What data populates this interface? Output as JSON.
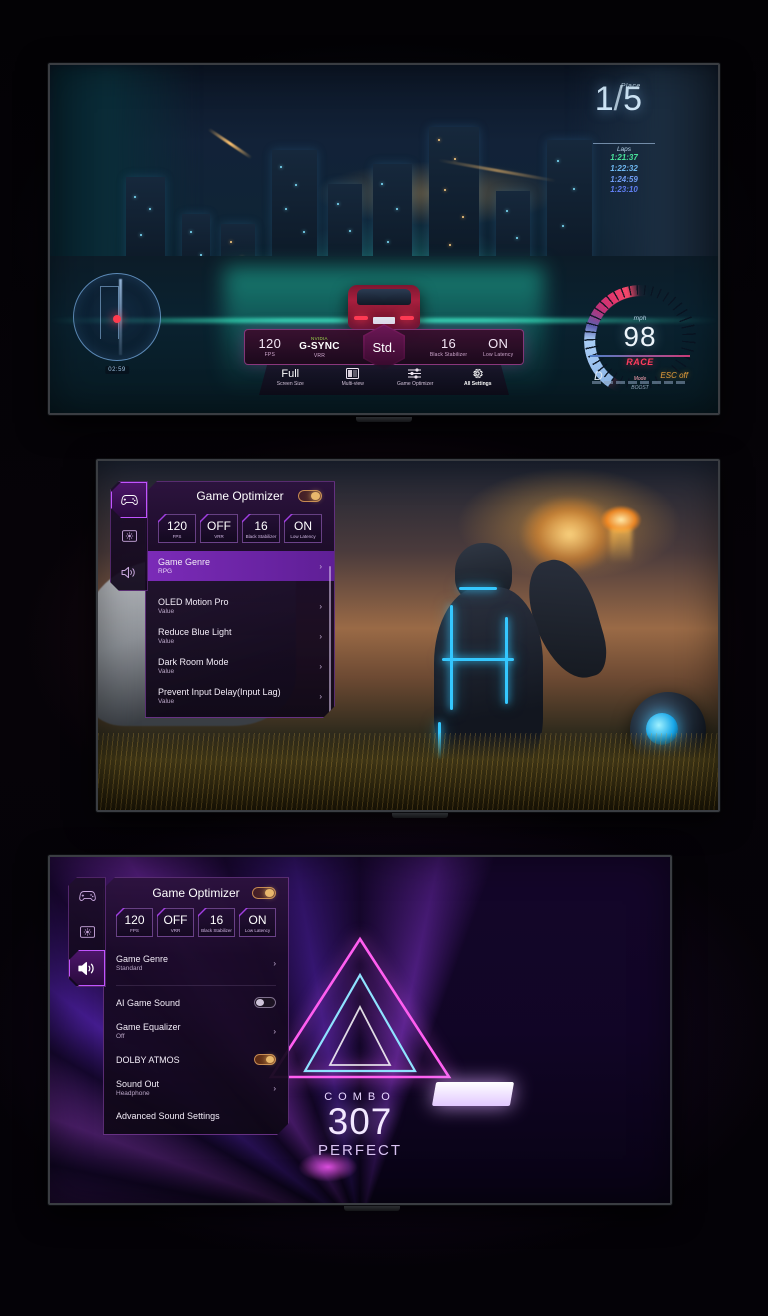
{
  "panel1": {
    "name": "LG TV racing game screen with Game Optimizer quick bar",
    "hud": {
      "place_label": "Place",
      "position": "1",
      "total": "5",
      "laps_label": "Laps",
      "lap_times": [
        "1:21:37",
        "1:22:32",
        "1:24:59",
        "1:23:10"
      ],
      "lap_colors": [
        "#49e39b",
        "#6fb9f2",
        "#6f9bf2",
        "#5f7df0"
      ],
      "minimap_time": "02:59",
      "speed": {
        "unit": "mph",
        "value": "98",
        "mode": "RACE",
        "mode_sub": "Mode",
        "gear": "D",
        "esc": "ESC off",
        "boost_label": "BOOST"
      }
    },
    "gamebar": {
      "stats": [
        {
          "value": "120",
          "label": "FPS"
        },
        {
          "value": "G-SYNC",
          "label": "VRR",
          "brand": "NVIDIA"
        },
        {
          "value": "16",
          "label": "Black Stabilizer"
        },
        {
          "value": "ON",
          "label": "Low Latency"
        }
      ],
      "mode": "Std.",
      "menu": [
        {
          "value": "Full",
          "label": "Screen Size",
          "icon": "text-icon",
          "active": false
        },
        {
          "value": "",
          "label": "Multi-view",
          "icon": "multiview-icon",
          "active": false
        },
        {
          "value": "",
          "label": "Game Optimizer",
          "icon": "sliders-icon",
          "active": false
        },
        {
          "value": "",
          "label": "All Settings",
          "icon": "gear-icon",
          "active": true
        }
      ],
      "help_icon": "question-icon"
    }
  },
  "panel2": {
    "name": "LG TV sci-fi game screen with Game Optimizer picture menu",
    "optimizer": {
      "title": "Game Optimizer",
      "toggle_on": true,
      "rail": [
        {
          "icon": "gamepad-icon",
          "name": "tab-game",
          "active": true
        },
        {
          "icon": "display-icon",
          "name": "tab-picture",
          "active": false
        },
        {
          "icon": "speaker-icon",
          "name": "tab-sound",
          "active": false
        }
      ],
      "chips": [
        {
          "value": "120",
          "label": "FPS"
        },
        {
          "value": "OFF",
          "label": "VRR"
        },
        {
          "value": "16",
          "label": "Black Stabilizer"
        },
        {
          "value": "ON",
          "label": "Low Latency"
        }
      ],
      "rows": [
        {
          "title": "Game Genre",
          "sub": "RPG",
          "control": "chevron",
          "selected": true
        },
        {
          "title": "OLED Motion Pro",
          "sub": "Value",
          "control": "chevron",
          "selected": false
        },
        {
          "title": "Reduce Blue Light",
          "sub": "Value",
          "control": "chevron",
          "selected": false
        },
        {
          "title": "Dark Room Mode",
          "sub": "Value",
          "control": "chevron",
          "selected": false
        },
        {
          "title": "Prevent Input Delay(Input Lag)",
          "sub": "Value",
          "control": "chevron",
          "selected": false
        }
      ]
    }
  },
  "panel3": {
    "name": "LG TV rhythm game screen with Game Optimizer sound menu",
    "optimizer": {
      "title": "Game Optimizer",
      "toggle_on": true,
      "rail": [
        {
          "icon": "gamepad-icon",
          "name": "tab-game",
          "active": false
        },
        {
          "icon": "display-icon",
          "name": "tab-picture",
          "active": false
        },
        {
          "icon": "speaker-icon",
          "name": "tab-sound",
          "active": true
        }
      ],
      "chips": [
        {
          "value": "120",
          "label": "FPS"
        },
        {
          "value": "OFF",
          "label": "VRR"
        },
        {
          "value": "16",
          "label": "Black Stabilizer"
        },
        {
          "value": "ON",
          "label": "Low Latency"
        }
      ],
      "rows": [
        {
          "title": "Game Genre",
          "sub": "Standard",
          "control": "chevron",
          "selected": false
        },
        {
          "title": "AI Game Sound",
          "sub": "",
          "control": "switch-off",
          "selected": false
        },
        {
          "title": "Game Equalizer",
          "sub": "Off",
          "control": "chevron",
          "selected": false
        },
        {
          "title": "DOLBY ATMOS",
          "sub": "",
          "control": "switch-on",
          "selected": false
        },
        {
          "title": "Sound Out",
          "sub": "Headphone",
          "control": "chevron",
          "selected": false
        },
        {
          "title": "Advanced Sound Settings",
          "sub": "",
          "control": "none",
          "selected": false
        }
      ]
    },
    "game": {
      "combo_label": "COMBO",
      "combo_value": "307",
      "judgement": "PERFECT"
    }
  },
  "colors": {
    "accent_purple": "#c154ff",
    "accent_magenta": "#e0356d",
    "toggle_gold": "#e8b76c",
    "hud_blue": "#cfe6f7",
    "page_bg": "#050306"
  }
}
